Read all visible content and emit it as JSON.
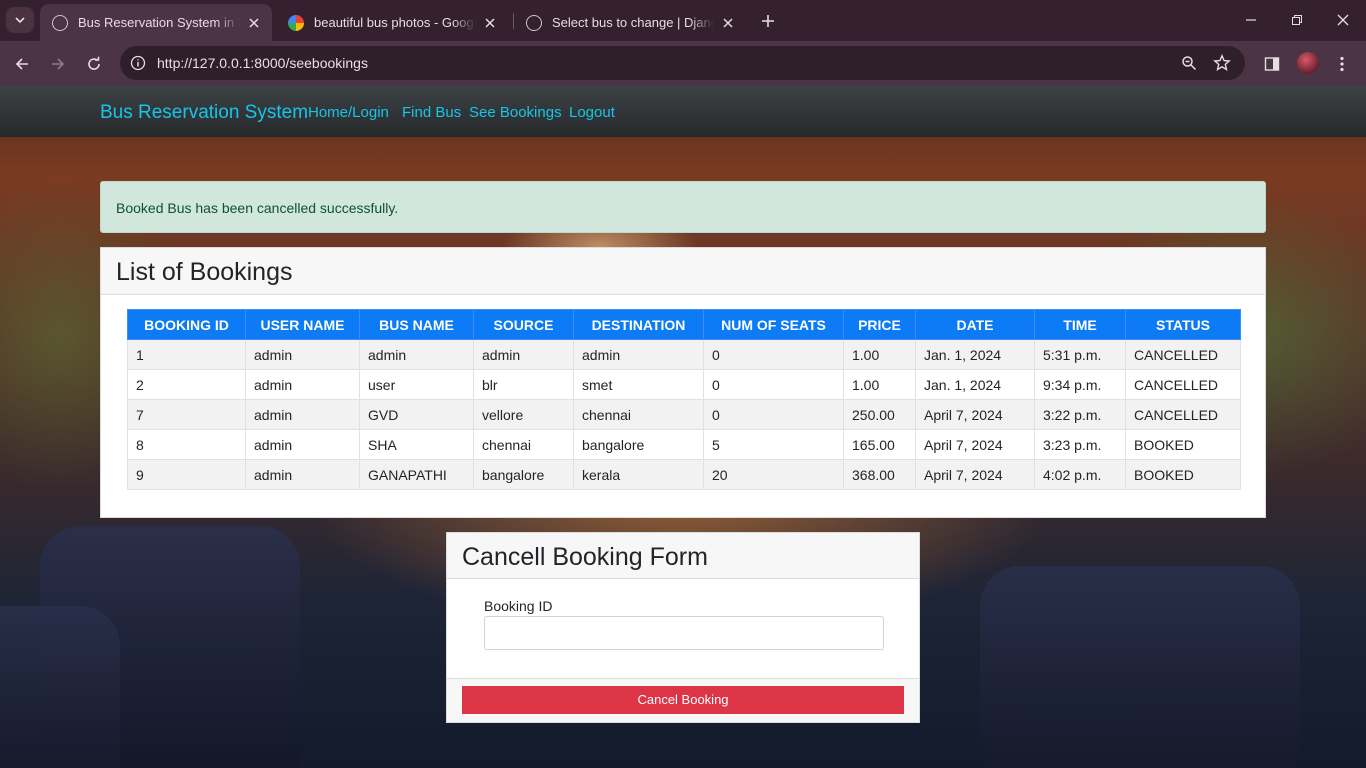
{
  "browser": {
    "tabs": [
      {
        "title": "Bus Reservation System in Django",
        "active": true
      },
      {
        "title": "beautiful bus photos - Google Search",
        "active": false
      },
      {
        "title": "Select bus to change | Django site admin",
        "active": false
      }
    ],
    "url": "http://127.0.0.1:8000/seebookings"
  },
  "navbar": {
    "brand": "Bus Reservation System",
    "links": [
      "Home/Login",
      "Find Bus",
      "See Bookings",
      "Logout"
    ]
  },
  "alert": {
    "message": "Booked Bus has been cancelled successfully."
  },
  "bookings": {
    "title": "List of Bookings",
    "columns": [
      "BOOKING ID",
      "USER NAME",
      "BUS NAME",
      "SOURCE",
      "DESTINATION",
      "NUM OF SEATS",
      "PRICE",
      "DATE",
      "TIME",
      "STATUS"
    ],
    "rows": [
      [
        "1",
        "admin",
        "admin",
        "admin",
        "admin",
        "0",
        "1.00",
        "Jan. 1, 2024",
        "5:31 p.m.",
        "CANCELLED"
      ],
      [
        "2",
        "admin",
        "user",
        "blr",
        "smet",
        "0",
        "1.00",
        "Jan. 1, 2024",
        "9:34 p.m.",
        "CANCELLED"
      ],
      [
        "7",
        "admin",
        "GVD",
        "vellore",
        "chennai",
        "0",
        "250.00",
        "April 7, 2024",
        "3:22 p.m.",
        "CANCELLED"
      ],
      [
        "8",
        "admin",
        "SHA",
        "chennai",
        "bangalore",
        "5",
        "165.00",
        "April 7, 2024",
        "3:23 p.m.",
        "BOOKED"
      ],
      [
        "9",
        "admin",
        "GANAPATHI",
        "bangalore",
        "kerala",
        "20",
        "368.00",
        "April 7, 2024",
        "4:02 p.m.",
        "BOOKED"
      ]
    ]
  },
  "cancel_form": {
    "title": "Cancell Booking Form",
    "field_label": "Booking ID",
    "field_value": "",
    "submit_label": "Cancel Booking"
  },
  "colors": {
    "link": "#17c5e8",
    "table_header": "#0d7bf6",
    "danger": "#dc3545",
    "alert_bg": "#d1e7dd"
  }
}
